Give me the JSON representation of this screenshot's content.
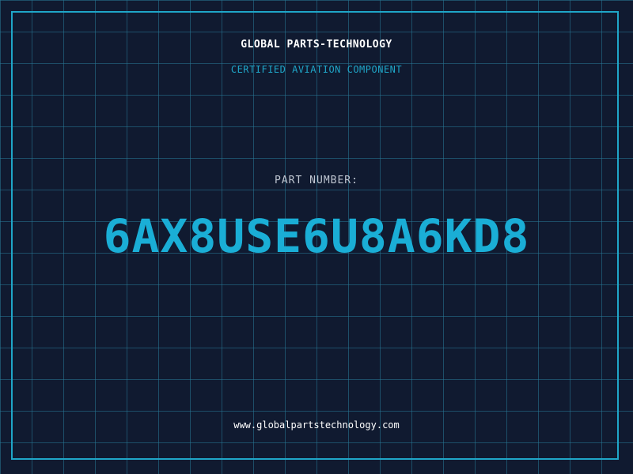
{
  "header": {
    "company": "GLOBAL PARTS-TECHNOLOGY",
    "tagline": "CERTIFIED AVIATION COMPONENT"
  },
  "part": {
    "label": "PART NUMBER:",
    "number": "6AX8USE6U8A6KD8"
  },
  "footer": {
    "website": "www.globalpartstechnology.com"
  },
  "colors": {
    "background": "#101a30",
    "grid": "#287896",
    "accent": "#1fa6c8",
    "text_primary": "#ffffff",
    "text_secondary": "#c0c7d2"
  }
}
